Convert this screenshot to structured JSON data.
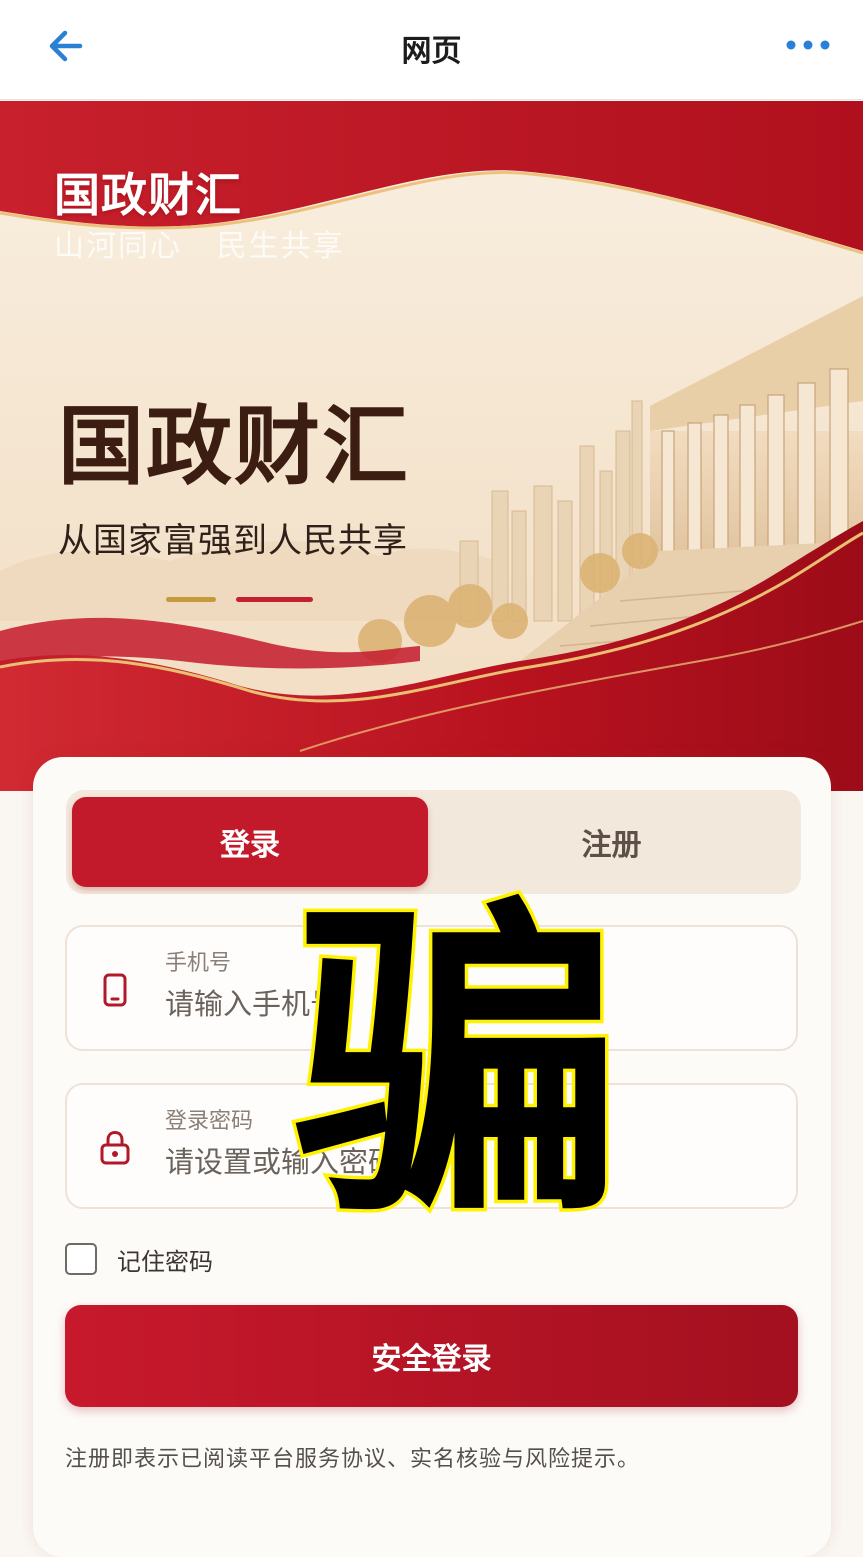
{
  "nav": {
    "title": "网页",
    "back_icon": "arrow-left-icon",
    "more_icon": "ellipsis-icon",
    "accent": "#2a7fd6"
  },
  "hero": {
    "brand": "国政财汇",
    "slogan": "山河同心   民生共享",
    "title": "国政财汇",
    "subtitle": "从国家富强到人民共享",
    "colors": {
      "red": "#c31a2b",
      "gold": "#c39a3c",
      "cream": "#f4e6d2"
    }
  },
  "tabs": {
    "login": "登录",
    "register": "注册",
    "active": "login"
  },
  "form": {
    "phone": {
      "label": "手机号",
      "placeholder": "请输入手机号",
      "icon": "phone-icon"
    },
    "password": {
      "label": "登录密码",
      "placeholder": "请设置或输入密码",
      "icon": "lock-icon"
    },
    "remember": {
      "label": "记住密码",
      "checked": false
    },
    "submit": "安全登录",
    "terms": "注册即表示已阅读平台服务协议、实名核验与风险提示。"
  },
  "overlay": {
    "character": "骗",
    "fill": "#000000",
    "outline": "#fff200"
  }
}
